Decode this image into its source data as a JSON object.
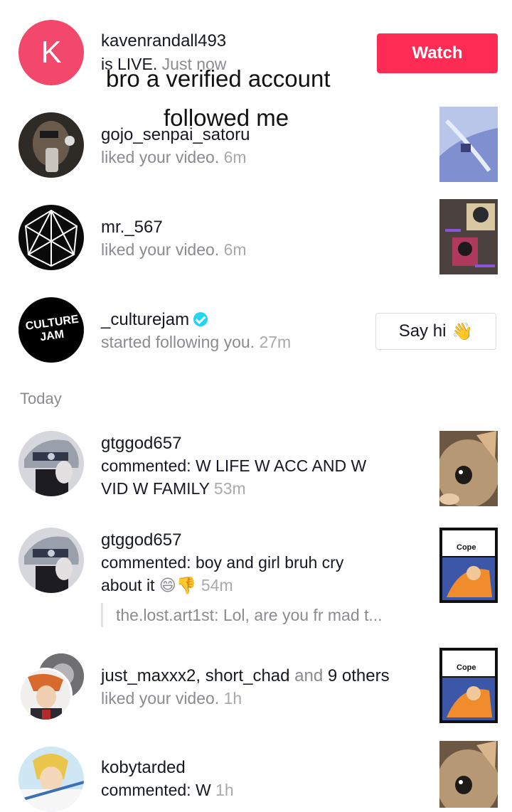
{
  "overlay": {
    "line1": "bro a verified account",
    "line2": "followed me"
  },
  "section_label": "Today",
  "notifications": [
    {
      "username": "kavenrandall493",
      "avatar_letter": "K",
      "action": "is LIVE.",
      "time": "Just now",
      "button": "Watch"
    },
    {
      "username": "gojo_senpai_satoru",
      "action": "liked your video.",
      "time": "6m"
    },
    {
      "username": "mr._567",
      "action": "liked your video.",
      "time": "6m"
    },
    {
      "username": "_culturejam",
      "avatar_text": "CULTURE JAM",
      "verified": true,
      "action": "started following you.",
      "time": "27m",
      "button": "Say hi",
      "button_emoji": "👋"
    },
    {
      "username": "gtggod657",
      "action_line1": "commented: W LIFE W ACC AND W",
      "action_line2": "VID W FAMILY",
      "time": "53m"
    },
    {
      "username": "gtggod657",
      "action_line1": "commented: boy and girl bruh cry",
      "action_line2": "about it",
      "emojis": "😄👎",
      "time": "54m",
      "reply": "the.lost.art1st: Lol, are you fr mad t..."
    },
    {
      "users_part1": "just_maxxx2",
      "sep1": ", ",
      "users_part2": "short_chad",
      "sep2": " and ",
      "users_part3": "9 others",
      "action": "liked your video.",
      "time": "1h"
    },
    {
      "username": "kobytarded",
      "action": "commented: W",
      "time": "1h"
    }
  ],
  "thumb_caption": "Cope",
  "colors": {
    "accent": "#fe2c55",
    "verified": "#20d5ec",
    "secondary_text": "#8a8b91"
  }
}
